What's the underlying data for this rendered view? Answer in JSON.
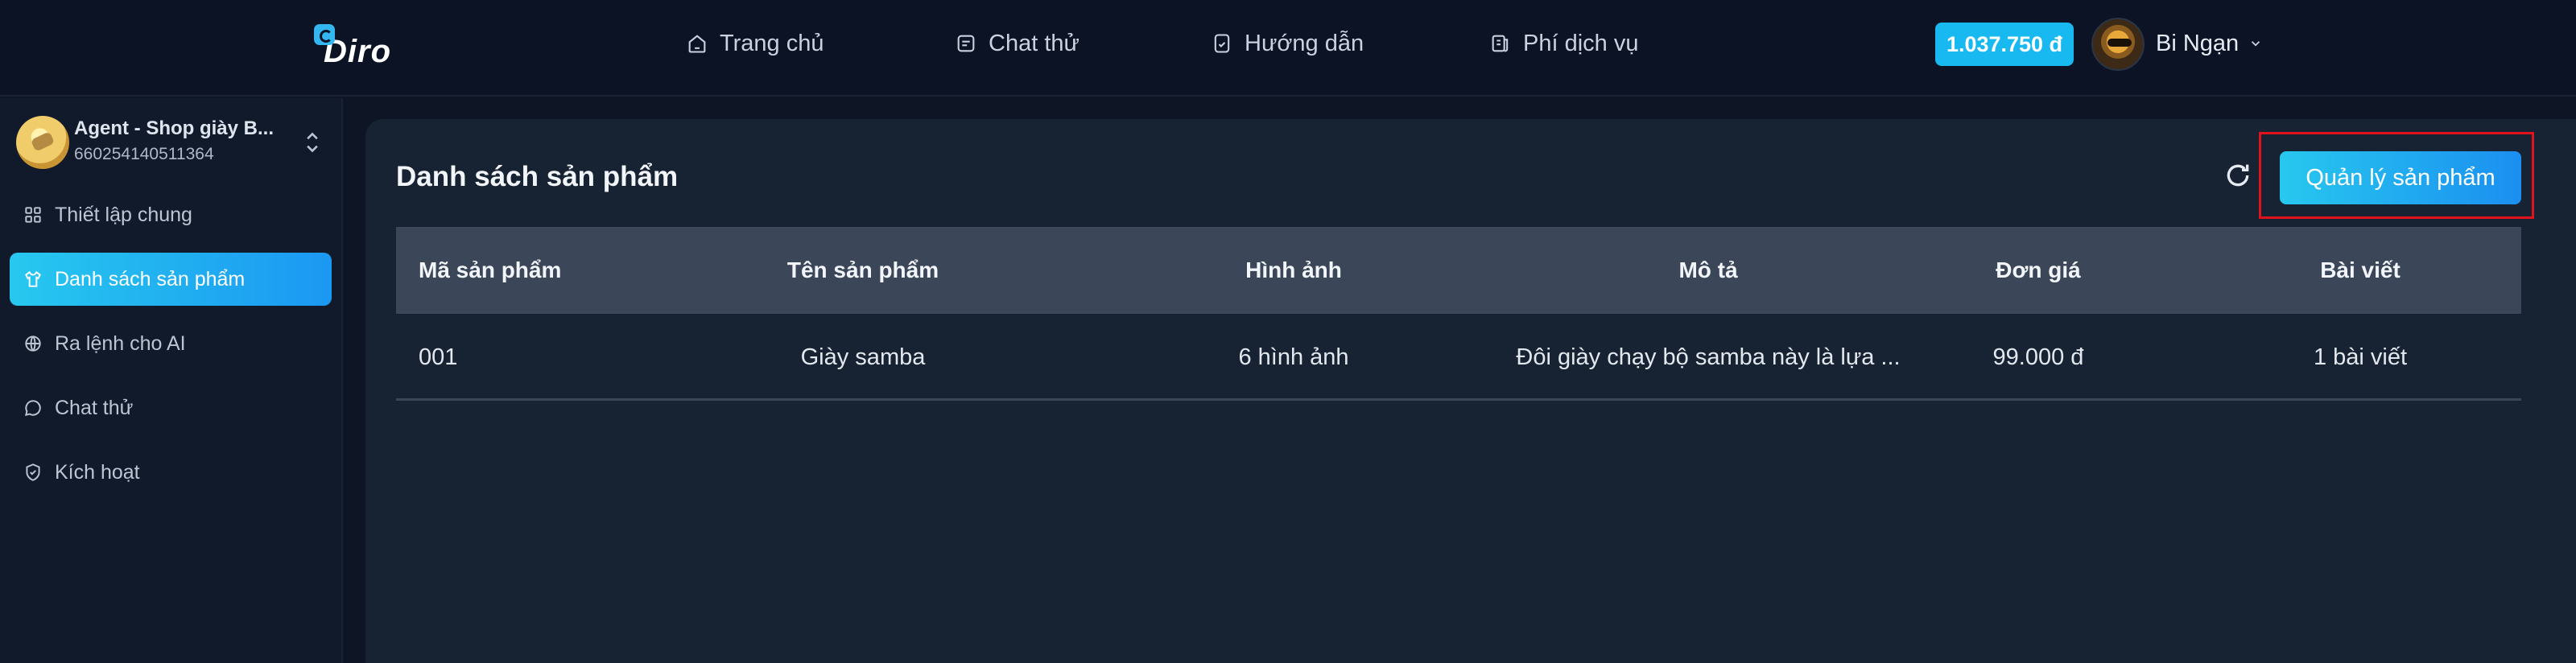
{
  "brand": {
    "name": "Diro",
    "accent": "#18b9f1",
    "highlight": "#e0121b"
  },
  "nav": [
    {
      "label": "Trang chủ",
      "icon": "home-icon"
    },
    {
      "label": "Chat thử",
      "icon": "chat-icon"
    },
    {
      "label": "Hướng dẫn",
      "icon": "book-icon"
    },
    {
      "label": "Phí dịch vụ",
      "icon": "fee-icon"
    }
  ],
  "header": {
    "balance": "1.037.750 đ",
    "user_name": "Bi Ngạn"
  },
  "sidebar": {
    "agent": {
      "name": "Agent - Shop giày B...",
      "id": "660254140511364"
    },
    "items": [
      {
        "label": "Thiết lập chung",
        "icon": "grid-icon",
        "active": false
      },
      {
        "label": "Danh sách sản phẩm",
        "icon": "shirt-icon",
        "active": true
      },
      {
        "label": "Ra lệnh cho AI",
        "icon": "globe-icon",
        "active": false
      },
      {
        "label": "Chat thử",
        "icon": "chat-bubble-icon",
        "active": false
      },
      {
        "label": "Kích hoạt",
        "icon": "shield-icon",
        "active": false
      }
    ]
  },
  "main": {
    "title": "Danh sách sản phẩm",
    "manage_button": "Quản lý sản phẩm",
    "table": {
      "columns": [
        "Mã sản phẩm",
        "Tên sản phẩm",
        "Hình ảnh",
        "Mô tả",
        "Đơn giá",
        "Bài viết"
      ],
      "rows": [
        [
          "001",
          "Giày samba",
          "6 hình ảnh",
          "Đôi giày chạy bộ samba này là lựa ...",
          "99.000 đ",
          "1 bài viết"
        ]
      ]
    }
  }
}
